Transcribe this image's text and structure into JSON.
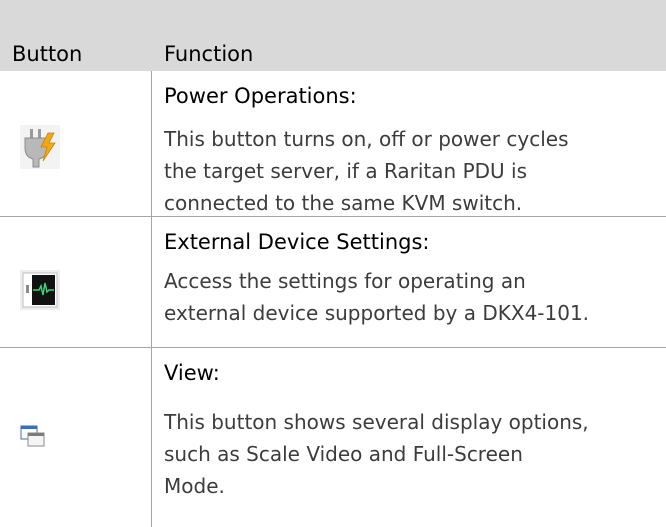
{
  "table": {
    "headers": {
      "button": "Button",
      "function": "Function"
    },
    "rows": [
      {
        "title": "Power Operations",
        "title_suffix": ":",
        "icon": "power-plug-icon",
        "description": [
          "This button turns on, off or power cycles",
          "the target server, if a Raritan PDU is",
          "connected to the same KVM switch."
        ]
      },
      {
        "title": "External Device Settings:",
        "icon": "external-device-icon",
        "description": [
          "Access the settings for operating an",
          "external device supported by a DKX4-101."
        ]
      },
      {
        "title": "View",
        "title_suffix": ":",
        "icon": "view-windows-icon",
        "description": [
          "This button shows several display options,",
          "such as Scale Video and Full-Screen",
          "Mode."
        ]
      }
    ]
  },
  "colors": {
    "header_bg": "#d9d9d9",
    "border": "#a6a6a6",
    "plug_bolt": "#f0a818",
    "screen_wave": "#3fd07a",
    "window_blue": "#3b6fb5"
  }
}
